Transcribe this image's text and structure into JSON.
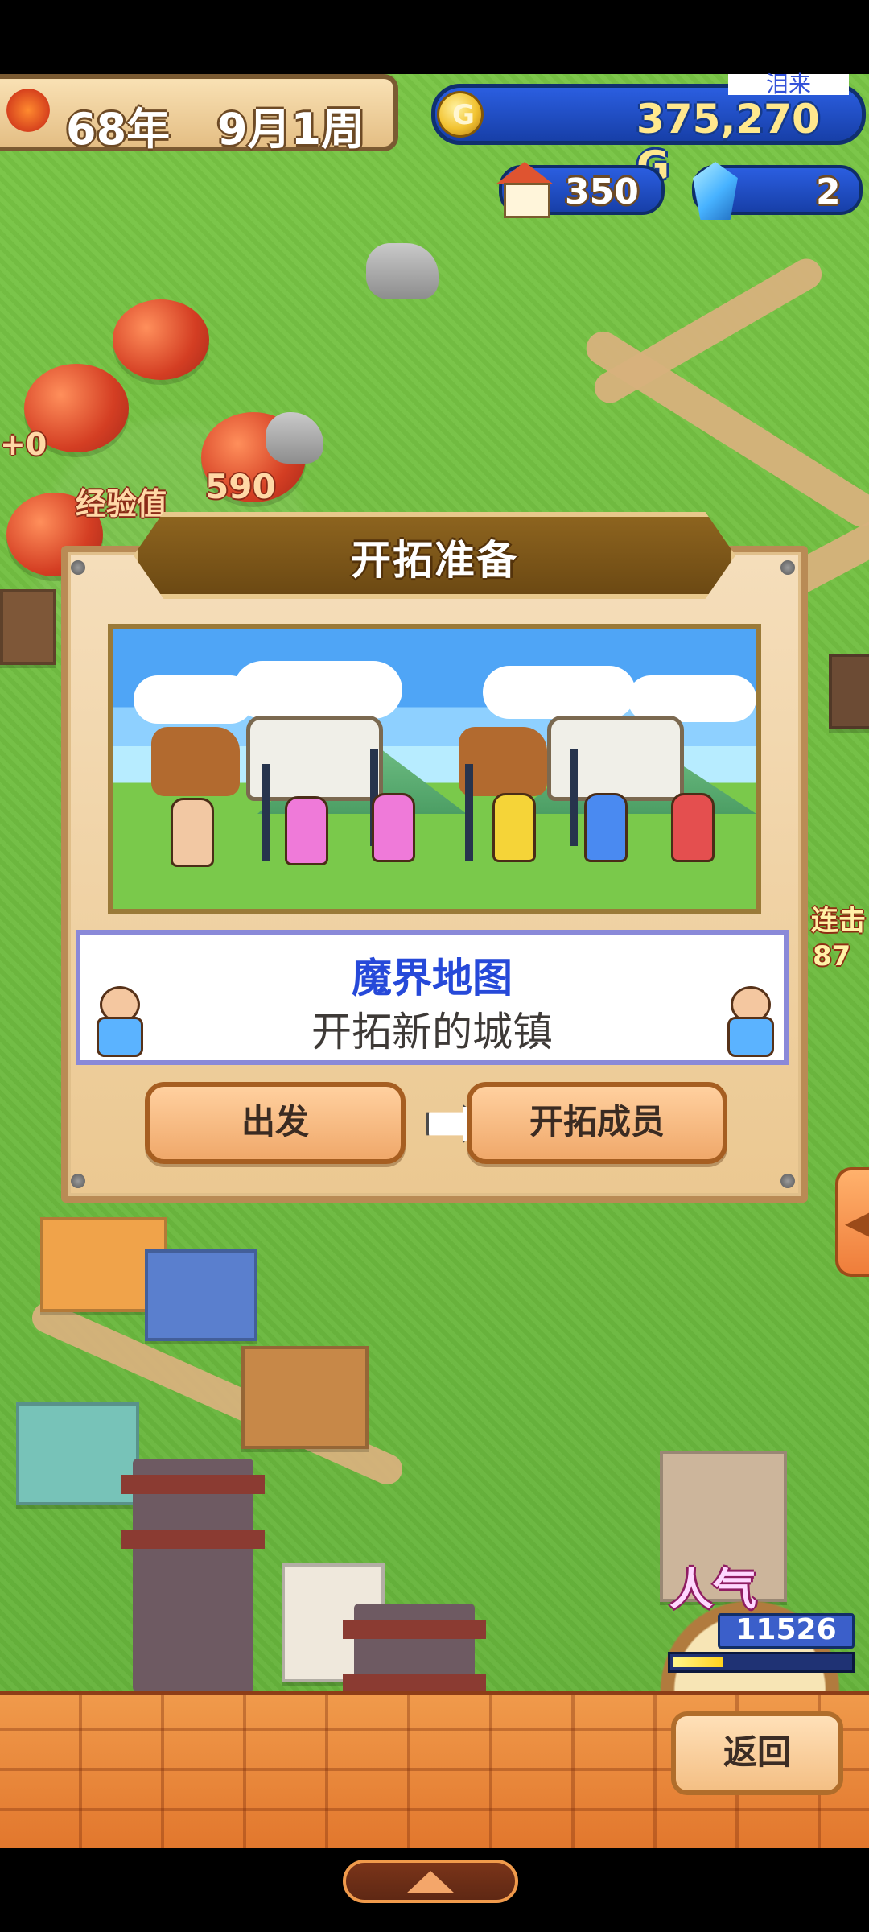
{
  "hud": {
    "year": "68年",
    "month_week": "9月1周",
    "coin_icon_label": "G",
    "coin_amount": "375,270 G",
    "houses": "350",
    "crystals": "2",
    "top_right_tag": "泪来"
  },
  "map_labels": {
    "left_plus": "+0",
    "exp_label": "经验值",
    "exp_value": "590",
    "right_label": "连击",
    "right_number": "87"
  },
  "dialog": {
    "title": "开拓准备",
    "map_name": "魔界地图",
    "description": "开拓新的城镇",
    "depart_button": "出发",
    "members_button": "开拓成员"
  },
  "popularity": {
    "label": "人气",
    "value": "11526",
    "fill_fraction": 0.28
  },
  "bottom": {
    "back_button": "返回"
  },
  "icons": {
    "coin": "coin-icon",
    "house": "house-icon",
    "crystal": "crystal-icon",
    "pointer": "pointing-hand-icon",
    "side_tab": "left-arrow-icon",
    "nav": "up-arrow-icon"
  }
}
